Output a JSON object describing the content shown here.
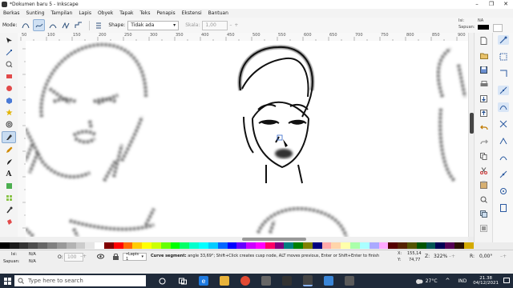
{
  "window": {
    "title": "*Dokumen baru 5 - Inkscape",
    "controls": [
      "–",
      "❐",
      "✕"
    ]
  },
  "menu": [
    "Berkas",
    "Sunting",
    "Tampilan",
    "Lapis",
    "Obyek",
    "Tapak",
    "Teks",
    "Penapis",
    "Ekstensi",
    "Bantuan"
  ],
  "tool_controls": {
    "mode_label": "Mode:",
    "shape_label": "Shape:",
    "shape_value": "Tidak ada",
    "scale_label": "Skala:",
    "scale_value": "1,00"
  },
  "style_indicator": {
    "fill_label": "Isi:",
    "fill_value": "NA",
    "stroke_label": "Sapuan:"
  },
  "ruler_labels": [
    "50",
    "100",
    "150",
    "200",
    "250",
    "300",
    "350",
    "400",
    "450",
    "500",
    "550",
    "600",
    "650",
    "700",
    "750",
    "800",
    "850",
    "900"
  ],
  "palette": [
    "#000000",
    "#1a1a1a",
    "#333333",
    "#4d4d4d",
    "#666666",
    "#808080",
    "#999999",
    "#b3b3b3",
    "#cccccc",
    "#e6e6e6",
    "#ffffff",
    "#800000",
    "#ff0000",
    "#ff6600",
    "#ffcc00",
    "#ffff00",
    "#ccff00",
    "#66ff00",
    "#00ff00",
    "#00ff66",
    "#00ffcc",
    "#00ffff",
    "#00ccff",
    "#0066ff",
    "#0000ff",
    "#6600ff",
    "#cc00ff",
    "#ff00ff",
    "#ff0066",
    "#800080",
    "#008080",
    "#008000",
    "#808000",
    "#000080",
    "#ffaaaa",
    "#ffd5aa",
    "#ffffaa",
    "#aaffaa",
    "#aaffff",
    "#aaaaff",
    "#ffaaff",
    "#550000",
    "#552200",
    "#555500",
    "#005500",
    "#005555",
    "#000055",
    "#550055",
    "#2b1100",
    "#d4aa00"
  ],
  "status": {
    "fill_label": "Isi:",
    "fill_value": "N/A",
    "stroke_label": "Sapuan:",
    "stroke_value": "N/A",
    "opacity_label": "O:",
    "opacity_value": "100",
    "layer_value": "•Lapis 1",
    "message_bold": "Curve segment:",
    "message": "angle 33,69°; Shift+Click creates cusp node, ALT moves previous, Enter or Shift+Enter to finish",
    "x_label": "X:",
    "x_value": "155,14",
    "y_label": "Y:",
    "y_value": "74,77",
    "zoom_label": "Z:",
    "zoom_value": "322%",
    "rotation_label": "R:",
    "rotation_value": "0,00°"
  },
  "taskbar": {
    "search_placeholder": "Type here to search",
    "temperature": "27°C",
    "language": "IND",
    "time": "21.38",
    "date": "04/12/2021"
  }
}
